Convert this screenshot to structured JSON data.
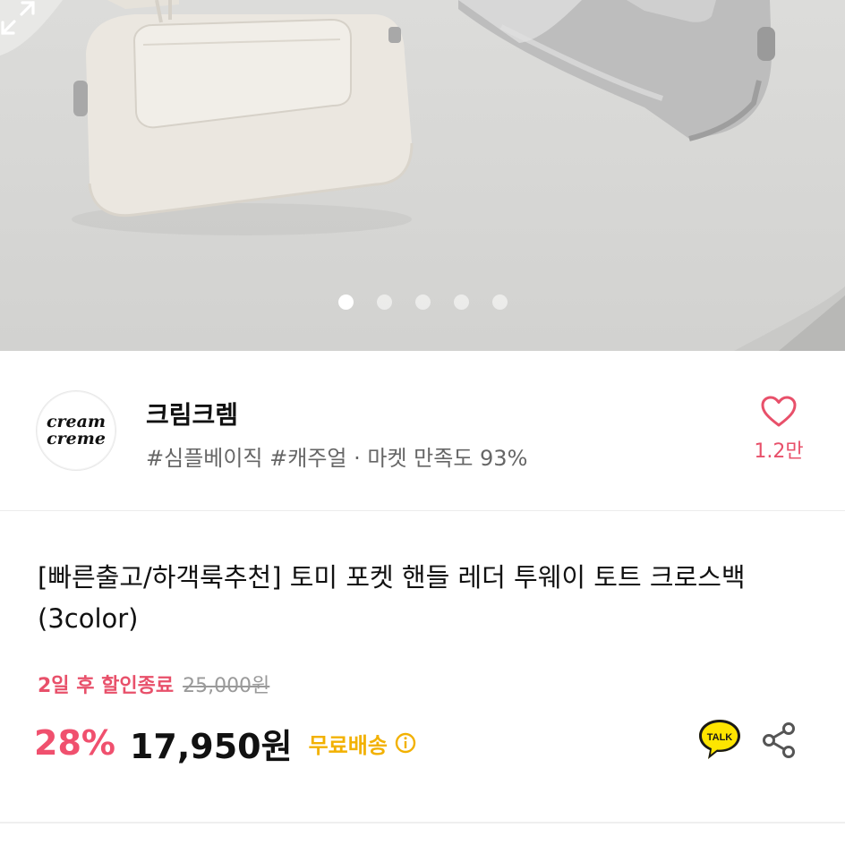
{
  "carousel": {
    "page_count": 5,
    "active_index": 0
  },
  "seller": {
    "logo_line1": "cream",
    "logo_line2": "creme",
    "name": "크림크렘",
    "tags": "#심플베이직 #캐주얼 · 마켓 만족도 93%",
    "like_count": "1.2만"
  },
  "product": {
    "title": "[빠른출고/하객룩추천] 토미 포켓 핸들 레더 투웨이 토트 크로스백(3color)",
    "discount_end": "2일 후 할인종료",
    "original_price": "25,000원",
    "discount_rate": "28%",
    "sale_price": "17,950원",
    "shipping": "무료배송"
  },
  "actions": {
    "talk_label": "TALK"
  },
  "colors": {
    "accent_pink": "#f0506e",
    "shipping_yellow": "#f2b100",
    "kakao_yellow": "#fee500"
  },
  "icons": [
    "expand-icon",
    "heart-icon",
    "info-icon",
    "kakao-talk-icon",
    "share-icon"
  ]
}
